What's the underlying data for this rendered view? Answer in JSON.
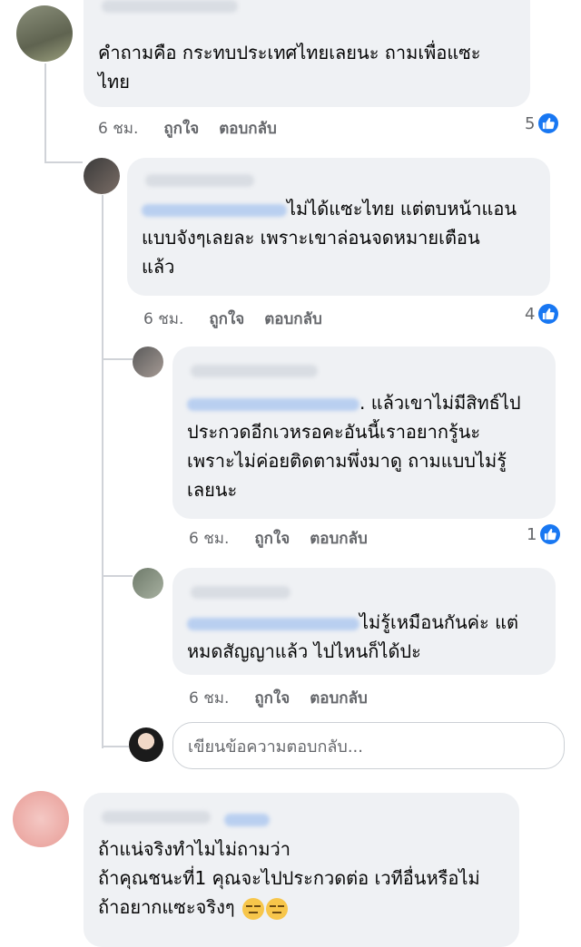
{
  "comments": [
    {
      "text": "คำถามคือ กระทบประเทศไทยเลยนะ ถามเพื่อแซะไทย",
      "line1": "คำถามคือ กระทบประเทศไทยเลยนะ ถามเพื่อแซะ",
      "line2": "ไทย",
      "time": "6 ชม.",
      "like": "ถูกใจ",
      "reply": "ตอบกลับ",
      "reactions": "5"
    },
    {
      "line1": "ไม่ได้แซะไทย แต่ตบหน้าแอน",
      "line2": "แบบจังๆเลยละ เพราะเขาล่อนจดหมายเตือน",
      "line3": "แล้ว",
      "time": "6 ชม.",
      "like": "ถูกใจ",
      "reply": "ตอบกลับ",
      "reactions": "4"
    },
    {
      "line1": ". แล้วเขาไม่มีสิทธ์ไป",
      "line2": "ประกวดอีกเวหรอคะอันนี้เราอยากรู้นะ",
      "line3": "เพราะไม่ค่อยติดตามพึ่งมาดู ถามแบบไม่รู้",
      "line4": "เลยนะ",
      "time": "6 ชม.",
      "like": "ถูกใจ",
      "reply": "ตอบกลับ",
      "reactions": "1"
    },
    {
      "line1": "ไม่รู้เหมือนกันค่ะ แต่",
      "line2": "หมดสัญญาแล้ว ไปไหนก็ได้ปะ",
      "time": "6 ชม.",
      "like": "ถูกใจ",
      "reply": "ตอบกลับ"
    },
    {
      "line1": "ถ้าแน่จริงทำไมไม่ถามว่า",
      "line2": "ถ้าคุณชนะที่1 คุณจะไปประกวดต่อ เวทีอื่นหรือไม่",
      "line3": "ถ้าอยากแซะจริงๆ"
    }
  ],
  "reply_box": {
    "placeholder": "เขียนข้อความตอบกลับ..."
  },
  "colors": {
    "like_blue": "#1877f2",
    "bubble": "#eff1f4",
    "meta_gray": "#65676b"
  },
  "icons": [
    "like-icon",
    "neutral-face-emoji"
  ]
}
